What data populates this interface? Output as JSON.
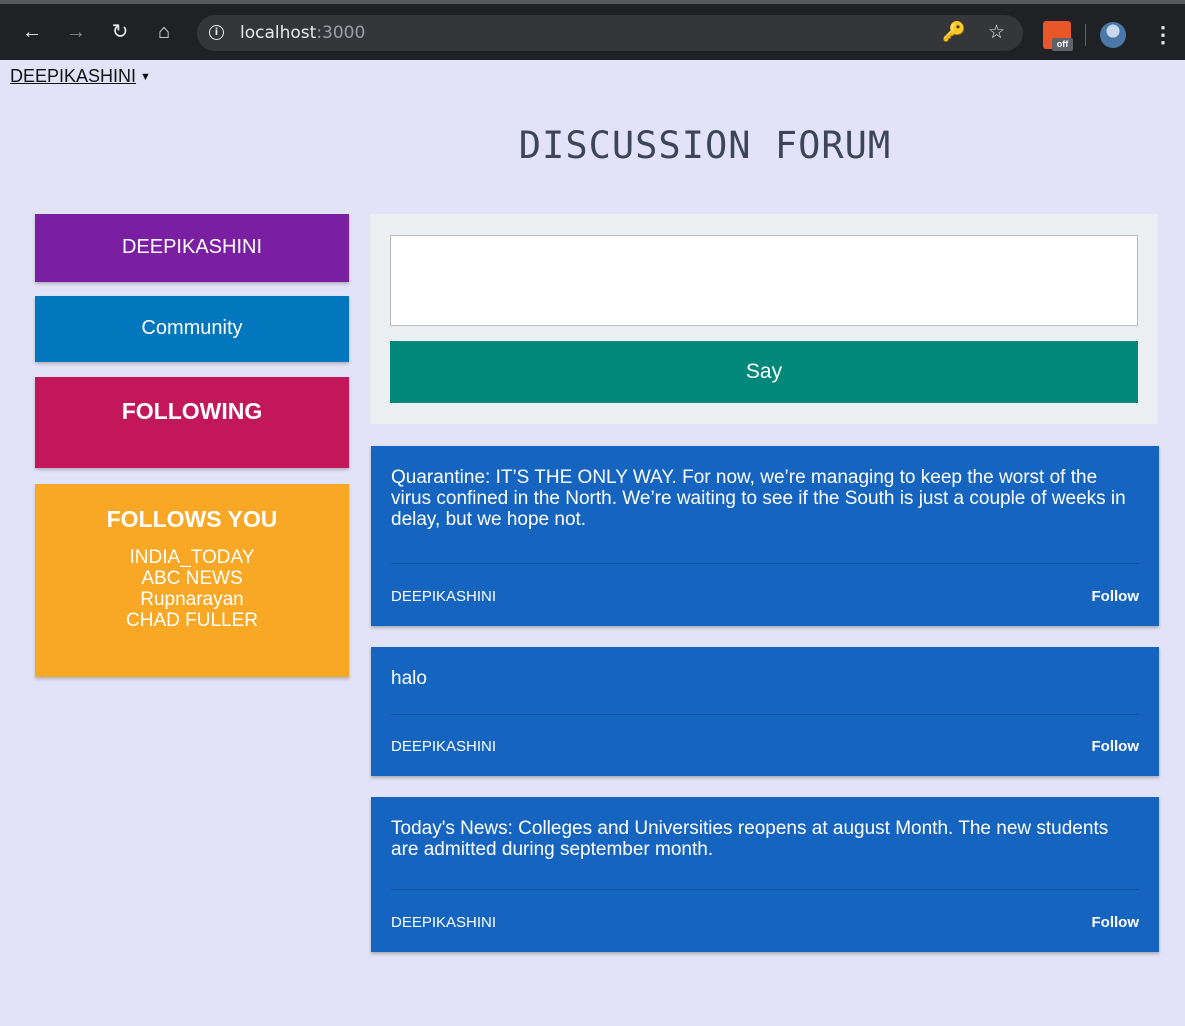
{
  "browser": {
    "url_host": "localhost",
    "url_port": ":3000",
    "extension_badge": "off"
  },
  "header": {
    "user_menu_label": "DEEPIKASHINI",
    "title": "DISCUSSION FORUM"
  },
  "sidebar": {
    "user_card": "DEEPIKASHINI",
    "community": "Community",
    "following": "FOLLOWING",
    "follows_you": {
      "title": "FOLLOWS YOU",
      "items": [
        "INDIA_TODAY",
        "ABC NEWS",
        "Rupnarayan",
        "CHAD FULLER"
      ]
    }
  },
  "composer": {
    "value": "",
    "button_label": "Say"
  },
  "posts": [
    {
      "text": "Quarantine: IT’S THE ONLY WAY. For now, we’re managing to keep the worst of the virus confined in the North. We’re waiting to see if the South is just a couple of weeks in delay, but we hope not.",
      "author": "DEEPIKASHINI",
      "action": "Follow"
    },
    {
      "text": "halo",
      "author": "DEEPIKASHINI",
      "action": "Follow"
    },
    {
      "text": "Today's News: Colleges and Universities reopens at august Month. The new students are admitted during september month.",
      "author": "DEEPIKASHINI",
      "action": "Follow"
    }
  ],
  "colors": {
    "page_bg": "#e3e3f8",
    "user_card": "#7b1fa2",
    "community_card": "#0277bd",
    "following_card": "#c2185b",
    "follows_you_card": "#f9a825",
    "say_button": "#00897b",
    "post_card": "#1565c0"
  }
}
